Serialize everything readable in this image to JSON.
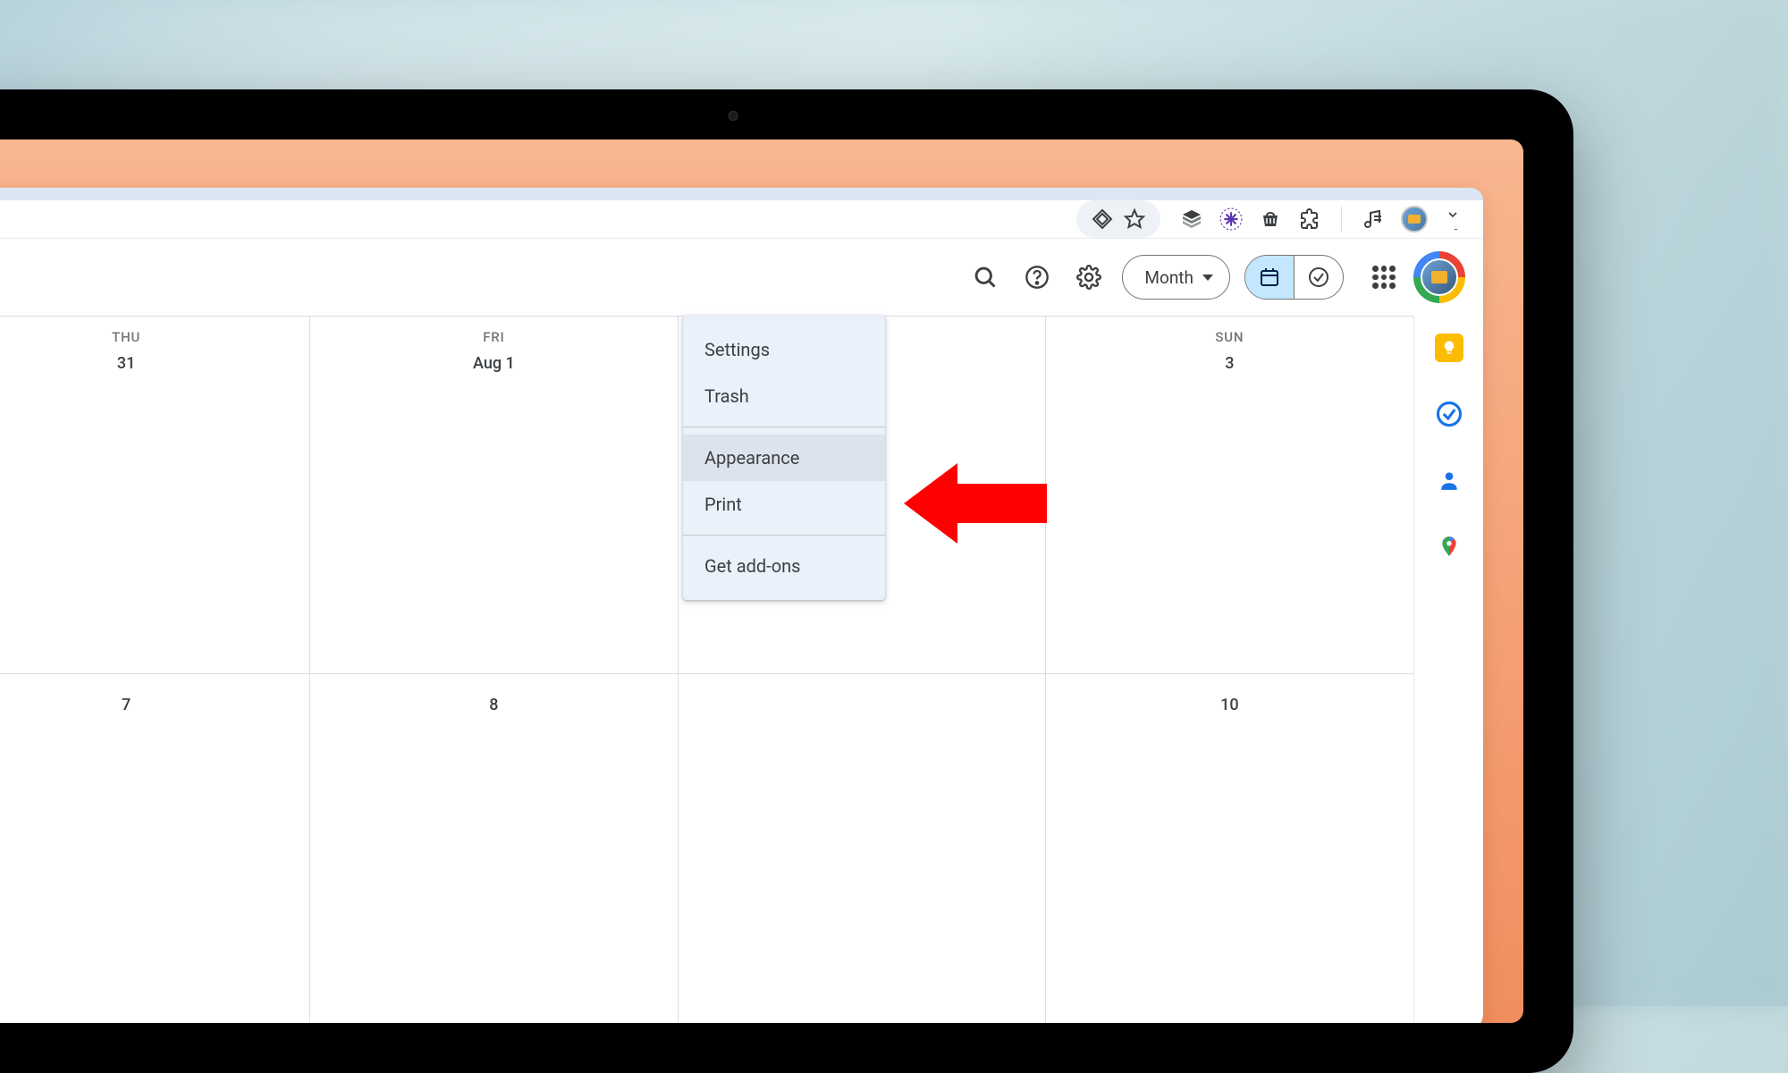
{
  "header": {
    "view_label": "Month"
  },
  "days": [
    {
      "dow": "THU",
      "date": "31"
    },
    {
      "dow": "FRI",
      "date": "Aug 1"
    },
    {
      "dow": "",
      "date": ""
    },
    {
      "dow": "SUN",
      "date": "3"
    },
    {
      "dow": "",
      "date": "7"
    },
    {
      "dow": "",
      "date": "8"
    },
    {
      "dow": "",
      "date": ""
    },
    {
      "dow": "",
      "date": "10"
    }
  ],
  "menu": {
    "settings": "Settings",
    "trash": "Trash",
    "appearance": "Appearance",
    "print": "Print",
    "addons": "Get add-ons"
  }
}
